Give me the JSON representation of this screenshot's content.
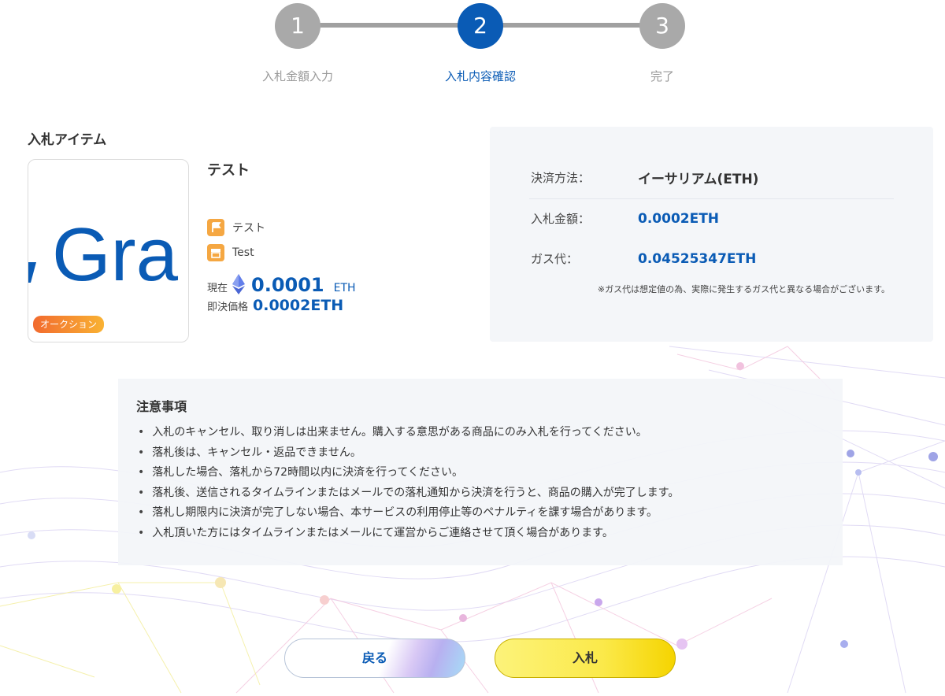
{
  "stepper": {
    "steps": [
      {
        "number": "1",
        "label": "入札金額入力"
      },
      {
        "number": "2",
        "label": "入札内容確認"
      },
      {
        "number": "3",
        "label": "完了"
      }
    ],
    "active_step": 2
  },
  "item": {
    "section_title": "入札アイテム",
    "image_text": "Gra",
    "badge": "オークション",
    "name": "テスト",
    "category_label": "テスト",
    "category_icon": "flag-icon",
    "shop_label": "Test",
    "shop_icon": "shop-icon",
    "current_label": "現在",
    "current_price": "0.0001",
    "current_unit": "ETH",
    "currency_icon": "ethereum-icon",
    "buynow_label": "即決価格",
    "buynow_price": "0.0002ETH"
  },
  "summary": {
    "payment_label": "決済方法：",
    "payment_value": "イーサリアム(ETH)",
    "bid_label": "入札金額：",
    "bid_value": "0.0002ETH",
    "gas_label": "ガス代：",
    "gas_value": "0.04525347ETH",
    "note": "※ガス代は想定値の為、実際に発生するガス代と異なる場合がございます。"
  },
  "notice": {
    "title": "注意事項",
    "items": [
      "入札のキャンセル、取り消しは出来ません。購入する意思がある商品にのみ入札を行ってください。",
      "落札後は、キャンセル・返品できません。",
      "落札した場合、落札から72時間以内に決済を行ってください。",
      "落札後、送信されるタイムラインまたはメールでの落札通知から決済を行うと、商品の購入が完了します。",
      "落札し期限内に決済が完了しない場合、本サービスの利用停止等のペナルティを課す場合があります。",
      "入札頂いた方にはタイムラインまたはメールにて運営からご連絡させて頂く場合があります。"
    ]
  },
  "buttons": {
    "back": "戻る",
    "bid": "入札"
  },
  "colors": {
    "accent": "#0a5bb5",
    "step_inactive": "#a9a9a9",
    "badge": "#f26a2e",
    "bid_button": "#fbe94a"
  }
}
